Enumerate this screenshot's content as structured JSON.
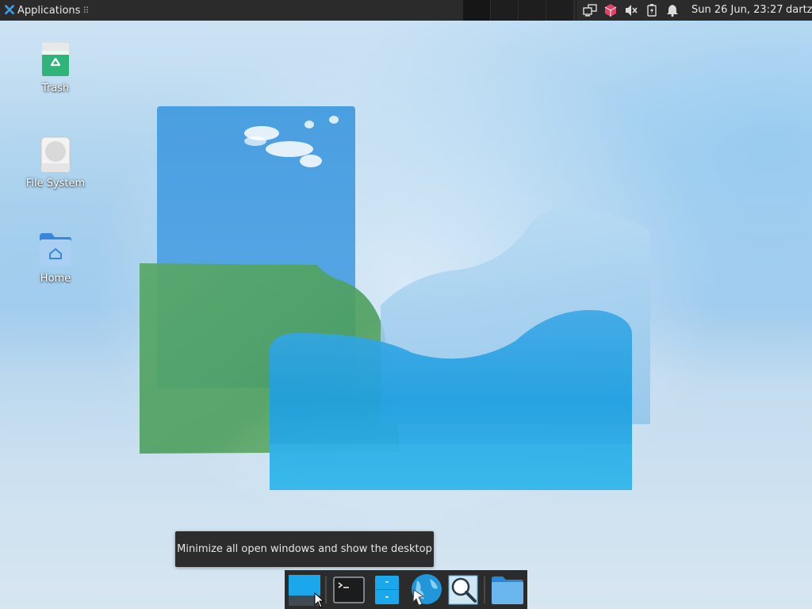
{
  "top_panel": {
    "applications_label": "Applications",
    "handle_glyph": "⠿",
    "clock": "Sun 26 Jun, 23:27",
    "user": "dartz",
    "tray_icons": [
      "network-icon",
      "package-updates-icon",
      "volume-muted-icon",
      "battery-icon",
      "notifications-bell-icon"
    ]
  },
  "desktop": {
    "icons": [
      {
        "label": "Trash",
        "icon": "trash-icon"
      },
      {
        "label": "File System",
        "icon": "harddrive-icon"
      },
      {
        "label": "Home",
        "icon": "home-folder-icon"
      }
    ]
  },
  "tooltip": {
    "text": "Minimize all open windows and show the desktop"
  },
  "dock": {
    "items": [
      "show-desktop-icon",
      "terminal-icon",
      "file-manager-icon",
      "web-browser-icon",
      "app-finder-icon",
      "files-folder-icon"
    ]
  },
  "colors": {
    "panel_bg": "#2b2b2b",
    "accent": "#1fa4e8",
    "text": "#e6e6e6"
  }
}
